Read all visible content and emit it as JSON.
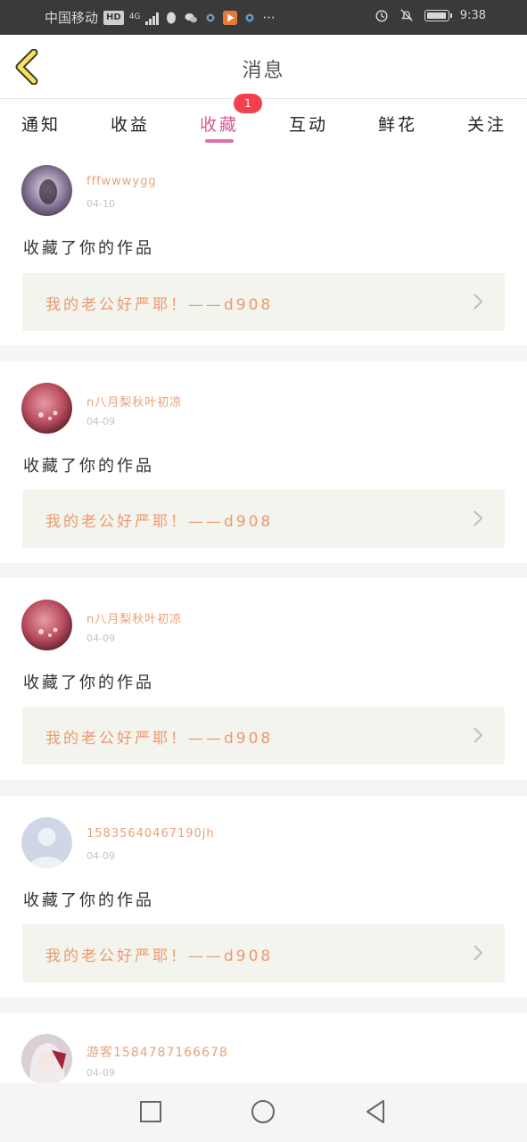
{
  "status_bar": {
    "carrier": "中国移动",
    "hd": "HD",
    "network": "4G",
    "more": "···",
    "time": "9:38"
  },
  "header": {
    "title": "消息"
  },
  "tabs": [
    {
      "label": "通知"
    },
    {
      "label": "收益"
    },
    {
      "label": "收藏",
      "active": true,
      "badge": "1"
    },
    {
      "label": "互动"
    },
    {
      "label": "鲜花"
    },
    {
      "label": "关注"
    }
  ],
  "messages": [
    {
      "username": "fffwwwygg",
      "date": "04-10",
      "action": "收藏了你的作品",
      "work_title": "我的老公好严耶！——d908",
      "avatar": "purple-photo"
    },
    {
      "username": "n八月梨秋叶初凉",
      "date": "04-09",
      "action": "收藏了你的作品",
      "work_title": "我的老公好严耶！——d908",
      "avatar": "pink-photo"
    },
    {
      "username": "n八月梨秋叶初凉",
      "date": "04-09",
      "action": "收藏了你的作品",
      "work_title": "我的老公好严耶！——d908",
      "avatar": "pink-photo"
    },
    {
      "username": "15835640467190jh",
      "date": "04-09",
      "action": "收藏了你的作品",
      "work_title": "我的老公好严耶！——d908",
      "avatar": "default-person"
    },
    {
      "username": "游客1584787166678",
      "date": "04-09",
      "action": "",
      "work_title": "",
      "avatar": "anime-photo"
    }
  ],
  "colors": {
    "accent": "#d65a96",
    "badge": "#f2404e",
    "username": "#e8a27a",
    "work_title": "#ea9a6e",
    "work_bg": "#f4f4ee",
    "back_icon": "#f4e06a"
  }
}
